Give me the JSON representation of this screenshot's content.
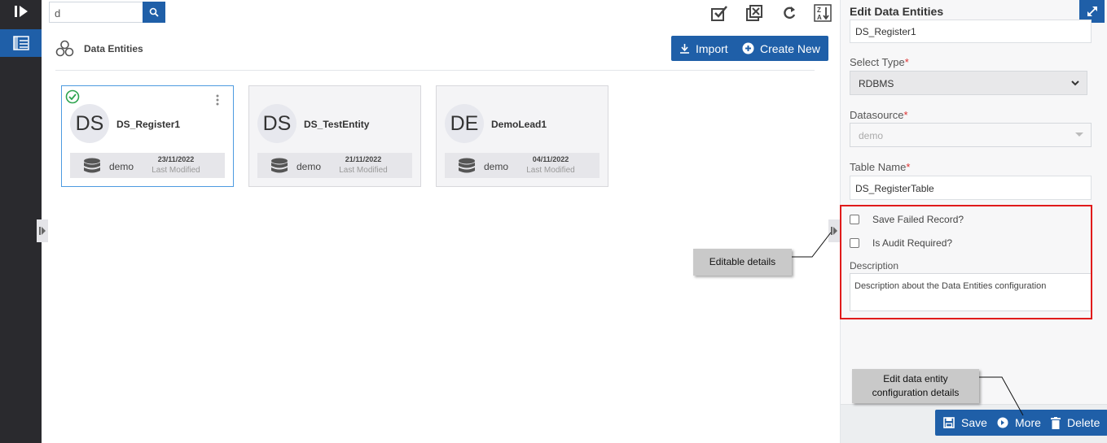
{
  "search": {
    "value": "d"
  },
  "breadcrumb": {
    "title": "Data Entities"
  },
  "header_buttons": {
    "import": "Import",
    "create_new": "Create New"
  },
  "cards": [
    {
      "initials": "DS",
      "name": "DS_Register1",
      "datasource": "demo",
      "date": "23/11/2022",
      "modified_label": "Last Modified",
      "selected": true
    },
    {
      "initials": "DS",
      "name": "DS_TestEntity",
      "datasource": "demo",
      "date": "21/11/2022",
      "modified_label": "Last Modified",
      "selected": false
    },
    {
      "initials": "DE",
      "name": "DemoLead1",
      "datasource": "demo",
      "date": "04/11/2022",
      "modified_label": "Last Modified",
      "selected": false
    }
  ],
  "panel": {
    "title": "Edit Data Entities",
    "name_value": "DS_Register1",
    "select_type_label": "Select Type",
    "select_type_value": "RDBMS",
    "datasource_label": "Datasource",
    "datasource_value": "demo",
    "table_name_label": "Table Name",
    "table_name_value": "DS_RegisterTable",
    "save_failed_label": "Save Failed Record?",
    "audit_label": "Is Audit Required?",
    "description_label": "Description",
    "description_value": "Description about the Data Entities configuration",
    "required_mark": "*",
    "buttons": {
      "save": "Save",
      "more": "More",
      "delete": "Delete"
    }
  },
  "callouts": {
    "editable": "Editable details",
    "edit_config_line1": "Edit data entity",
    "edit_config_line2": "configuration details"
  },
  "colors": {
    "accent": "#1f5fa8",
    "highlight": "#e01b1b",
    "success": "#2ea44f"
  },
  "icons": [
    "play-logo-icon",
    "entities-nav-icon",
    "search-icon",
    "check-all-icon",
    "uncheck-all-icon",
    "refresh-icon",
    "sort-za-icon",
    "entities-cluster-icon",
    "download-icon",
    "plus-circle-icon",
    "check-circle-icon",
    "kebab-icon",
    "database-icon",
    "collapse-arrow-icon",
    "expand-icon",
    "chevron-down-icon",
    "save-icon",
    "delete-icon"
  ]
}
